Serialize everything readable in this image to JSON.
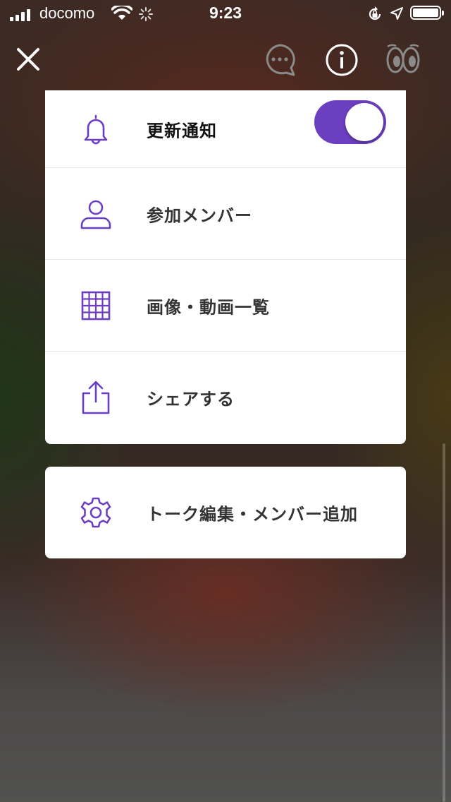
{
  "status_bar": {
    "carrier": "docomo",
    "time": "9:23"
  },
  "nav": {
    "icons": [
      "close-icon",
      "chat-bubble-icon",
      "info-icon",
      "eyes-icon"
    ]
  },
  "menu": {
    "items": [
      {
        "label": "更新通知",
        "icon": "bell-icon",
        "toggle_on": true
      },
      {
        "label": "参加メンバー",
        "icon": "person-icon"
      },
      {
        "label": "画像・動画一覧",
        "icon": "grid-icon"
      },
      {
        "label": "シェアする",
        "icon": "share-icon"
      }
    ]
  },
  "settings": {
    "label": "トーク編集・メンバー追加",
    "icon": "gear-icon"
  },
  "colors": {
    "accent": "#6c3fc0",
    "card": "#ffffff",
    "text": "#333333"
  }
}
